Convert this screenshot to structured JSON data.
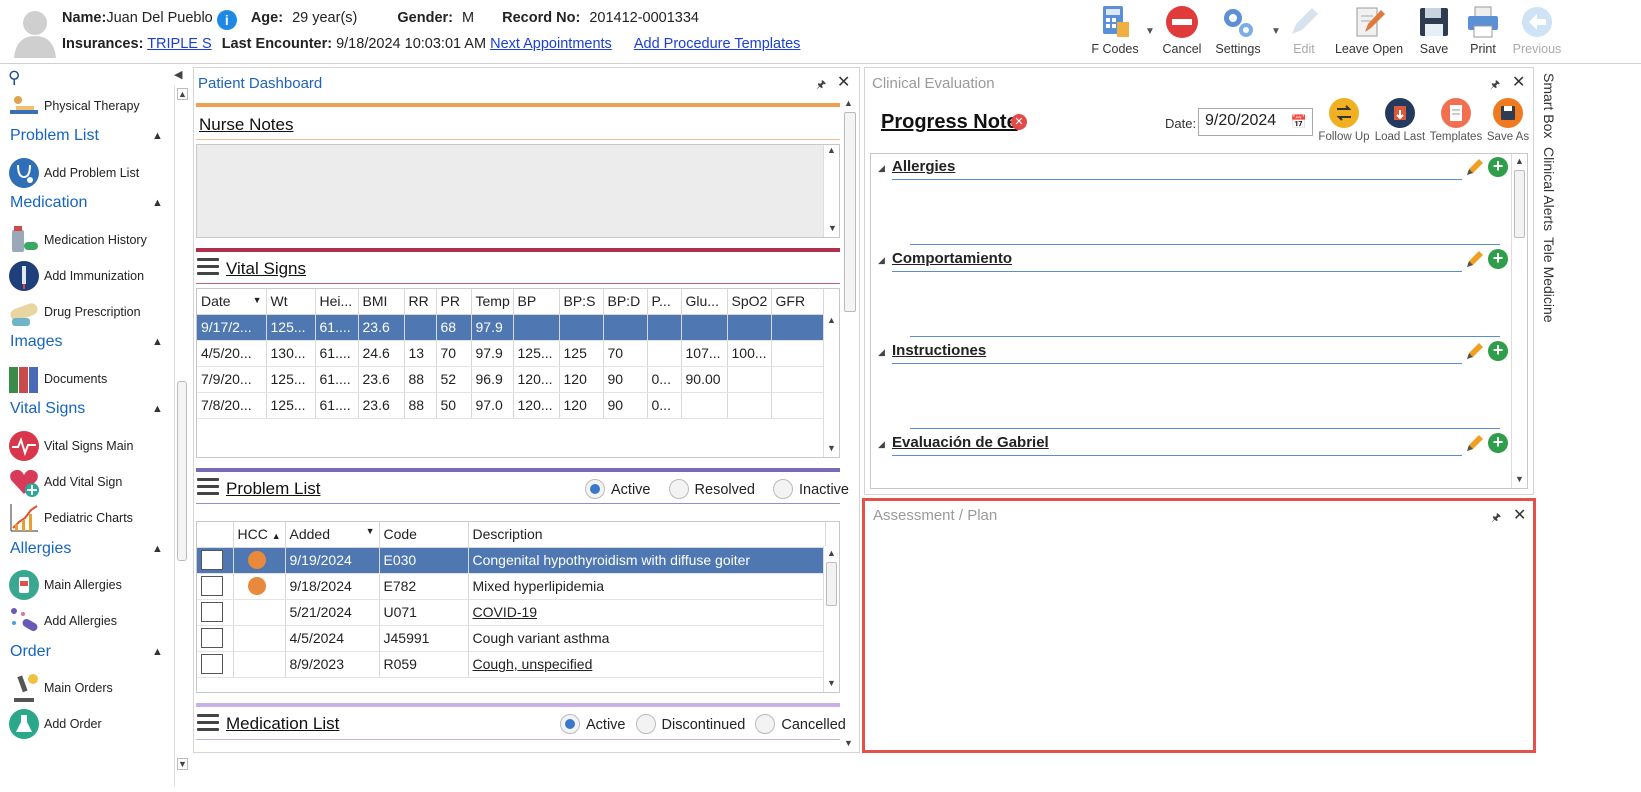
{
  "header": {
    "name_label": "Name:",
    "name_value": "Juan Del Pueblo",
    "info_icon": "i",
    "age_label": "Age:",
    "age_value": "29 year(s)",
    "gender_label": "Gender:",
    "gender_value": "M",
    "record_label": "Record No:",
    "record_value": "201412-0001334",
    "insurances_label": "Insurances:",
    "insurances_value": "TRIPLE S",
    "last_encounter_label": "Last Encounter:",
    "last_encounter_value": "9/18/2024 10:03:01 AM",
    "next_appointments": "Next Appointments",
    "add_procedure_templates": "Add Procedure Templates"
  },
  "toolbar": {
    "fcodes": "F Codes",
    "cancel": "Cancel",
    "settings": "Settings",
    "edit": "Edit",
    "leave_open": "Leave Open",
    "save": "Save",
    "print": "Print",
    "previous": "Previous"
  },
  "nav": {
    "item_physical_therapy": "Physical Therapy",
    "sec_problem_list": "Problem List",
    "item_add_problem_list": "Add Problem List",
    "sec_medication": "Medication",
    "item_medication_history": "Medication History",
    "item_add_immunization": "Add Immunization",
    "item_drug_prescription": "Drug Prescription",
    "sec_images": "Images",
    "item_documents": "Documents",
    "sec_vital_signs": "Vital Signs",
    "item_vital_signs_main": "Vital Signs Main",
    "item_add_vital_sign": "Add Vital Sign",
    "item_pediatric_charts": "Pediatric Charts",
    "sec_allergies": "Allergies",
    "item_main_allergies": "Main Allergies",
    "item_add_allergies": "Add Allergies",
    "sec_order": "Order",
    "item_main_orders": "Main Orders",
    "item_add_order": "Add Order"
  },
  "dashboard": {
    "title": "Patient Dashboard",
    "nurse_notes_title": "Nurse Notes",
    "vital_signs_title": "Vital Signs",
    "vital_columns": [
      "Date",
      "Wt",
      "Hei...",
      "BMI",
      "RR",
      "PR",
      "Temp",
      "BP",
      "BP:S",
      "BP:D",
      "P...",
      "Glu...",
      "SpO2",
      "GFR"
    ],
    "vital_rows": [
      [
        "9/17/2...",
        "125...",
        "61....",
        "23.6",
        "",
        "68",
        "97.9",
        "",
        "",
        "",
        "",
        "",
        "",
        ""
      ],
      [
        "4/5/20...",
        "130...",
        "61....",
        "24.6",
        "13",
        "70",
        "97.9",
        "125...",
        "125",
        "70",
        "",
        "107...",
        "100...",
        ""
      ],
      [
        "7/9/20...",
        "125...",
        "61....",
        "23.6",
        "88",
        "52",
        "96.9",
        "120...",
        "120",
        "90",
        "0...",
        "90.00",
        "",
        ""
      ],
      [
        "7/8/20...",
        "125...",
        "61....",
        "23.6",
        "88",
        "50",
        "97.0",
        "120...",
        "120",
        "90",
        "0...",
        "",
        "",
        ""
      ]
    ],
    "problem_list_title": "Problem List",
    "problem_filters": [
      "Active",
      "Resolved",
      "Inactive"
    ],
    "problem_columns": [
      "",
      "HCC",
      "Added",
      "Code",
      "Description"
    ],
    "problem_rows": [
      {
        "hcc": true,
        "added": "9/19/2024",
        "code": "E030",
        "description": "Congenital hypothyroidism with diffuse goiter",
        "link": false
      },
      {
        "hcc": true,
        "added": "9/18/2024",
        "code": "E782",
        "description": "Mixed hyperlipidemia",
        "link": false
      },
      {
        "hcc": false,
        "added": "5/21/2024",
        "code": "U071",
        "description": "COVID-19",
        "link": true
      },
      {
        "hcc": false,
        "added": "4/5/2024",
        "code": "J45991",
        "description": "Cough variant asthma",
        "link": false
      },
      {
        "hcc": false,
        "added": "8/9/2023",
        "code": "R059",
        "description": "Cough, unspecified",
        "link": true
      }
    ],
    "medication_list_title": "Medication List",
    "medication_filters": [
      "Active",
      "Discontinued",
      "Cancelled"
    ]
  },
  "clinical": {
    "title": "Clinical Evaluation",
    "progress_note": "Progress Note",
    "date_label": "Date:",
    "date_value": "9/20/2024",
    "btn_follow_up": "Follow Up",
    "btn_load_last": "Load Last",
    "btn_templates": "Templates",
    "btn_save_as": "Save As",
    "sections": [
      "Allergies",
      "Comportamiento",
      "Instructiones",
      "Evaluación de Gabriel"
    ]
  },
  "assessment": {
    "title": "Assessment / Plan"
  },
  "side_tabs": [
    "Smart Box",
    "Clinical Alerts",
    "Tele Medicine"
  ],
  "colors": {
    "accent_blue": "#1565c0",
    "selected_row": "#4f77b1",
    "hcc_orange": "#e8893c",
    "highlight_red": "#e2514a",
    "bar_orange": "#f0a050",
    "bar_crimson": "#b03050",
    "bar_purple": "#7a68b8"
  }
}
